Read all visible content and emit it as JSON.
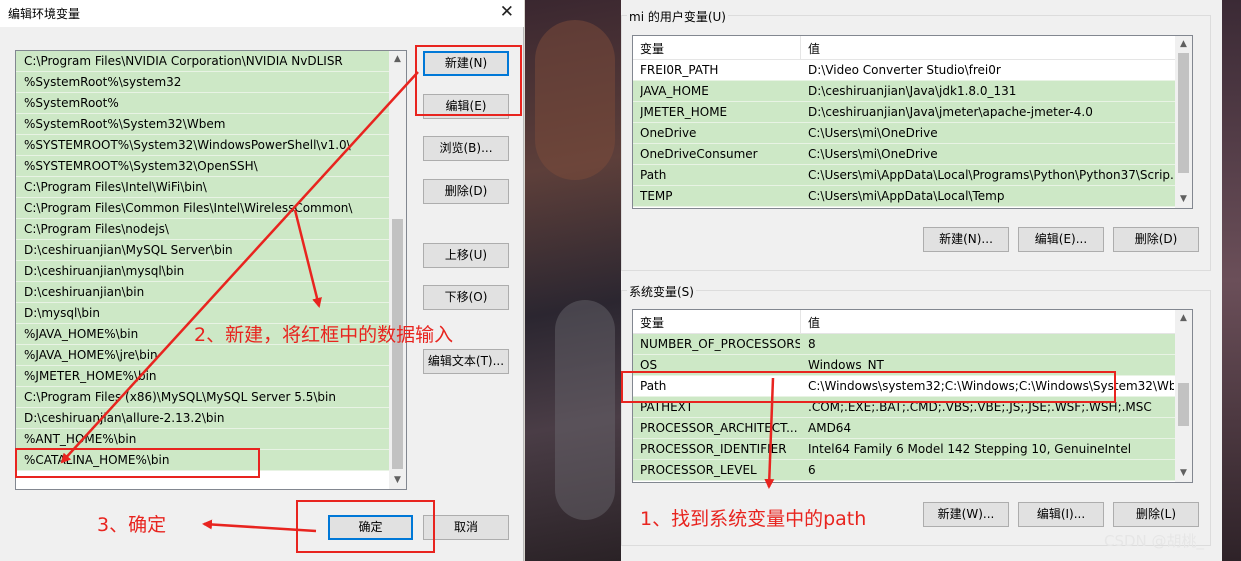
{
  "edit_dialog": {
    "title": "编辑环境变量",
    "close_glyph": "✕",
    "paths": [
      "C:\\Program Files\\NVIDIA Corporation\\NVIDIA NvDLISR",
      "%SystemRoot%\\system32",
      "%SystemRoot%",
      "%SystemRoot%\\System32\\Wbem",
      "%SYSTEMROOT%\\System32\\WindowsPowerShell\\v1.0\\",
      "%SYSTEMROOT%\\System32\\OpenSSH\\",
      "C:\\Program Files\\Intel\\WiFi\\bin\\",
      "C:\\Program Files\\Common Files\\Intel\\WirelessCommon\\",
      "C:\\Program Files\\nodejs\\",
      "D:\\ceshiruanjian\\MySQL Server\\bin",
      "D:\\ceshiruanjian\\mysql\\bin",
      "D:\\ceshiruanjian\\bin",
      "D:\\mysql\\bin",
      "%JAVA_HOME%\\bin",
      "%JAVA_HOME%\\jre\\bin",
      "%JMETER_HOME%\\bin",
      "C:\\Program Files (x86)\\MySQL\\MySQL Server 5.5\\bin",
      "D:\\ceshiruanjian\\allure-2.13.2\\bin",
      "%ANT_HOME%\\bin",
      "%CATALINA_HOME%\\bin"
    ],
    "buttons": {
      "new": "新建(N)",
      "edit": "编辑(E)",
      "browse": "浏览(B)...",
      "delete": "删除(D)",
      "move_up": "上移(U)",
      "move_down": "下移(O)",
      "edit_text": "编辑文本(T)...",
      "ok": "确定",
      "cancel": "取消"
    }
  },
  "env_window": {
    "user_group_label": "mi 的用户变量(U)",
    "columns": {
      "name": "变量",
      "value": "值"
    },
    "user_vars": [
      {
        "name": "FREI0R_PATH",
        "value": "D:\\Video Converter Studio\\frei0r"
      },
      {
        "name": "JAVA_HOME",
        "value": "D:\\ceshiruanjian\\Java\\jdk1.8.0_131"
      },
      {
        "name": "JMETER_HOME",
        "value": "D:\\ceshiruanjian\\Java\\jmeter\\apache-jmeter-4.0"
      },
      {
        "name": "OneDrive",
        "value": "C:\\Users\\mi\\OneDrive"
      },
      {
        "name": "OneDriveConsumer",
        "value": "C:\\Users\\mi\\OneDrive"
      },
      {
        "name": "Path",
        "value": "C:\\Users\\mi\\AppData\\Local\\Programs\\Python\\Python37\\Scrip..."
      },
      {
        "name": "TEMP",
        "value": "C:\\Users\\mi\\AppData\\Local\\Temp"
      }
    ],
    "user_buttons": {
      "new": "新建(N)...",
      "edit": "编辑(E)...",
      "delete": "删除(D)"
    },
    "system_group_label": "系统变量(S)",
    "system_vars": [
      {
        "name": "NUMBER_OF_PROCESSORS",
        "value": "8"
      },
      {
        "name": "OS",
        "value": "Windows_NT"
      },
      {
        "name": "Path",
        "value": "C:\\Windows\\system32;C:\\Windows;C:\\Windows\\System32\\Wb..."
      },
      {
        "name": "PATHEXT",
        "value": ".COM;.EXE;.BAT;.CMD;.VBS;.VBE;.JS;.JSE;.WSF;.WSH;.MSC"
      },
      {
        "name": "PROCESSOR_ARCHITECT...",
        "value": "AMD64"
      },
      {
        "name": "PROCESSOR_IDENTIFIER",
        "value": "Intel64 Family 6 Model 142 Stepping 10, GenuineIntel"
      },
      {
        "name": "PROCESSOR_LEVEL",
        "value": "6"
      }
    ],
    "system_buttons": {
      "new": "新建(W)...",
      "edit": "编辑(I)...",
      "delete": "删除(L)"
    }
  },
  "annotations": {
    "step1": "1、找到系统变量中的path",
    "step2": "2、新建，将红框中的数据输入",
    "step3": "3、确定",
    "color": "#e8241f"
  },
  "watermark": "CSDN @胡桃_",
  "scroll_glyphs": {
    "up": "▲",
    "down": "▼"
  }
}
